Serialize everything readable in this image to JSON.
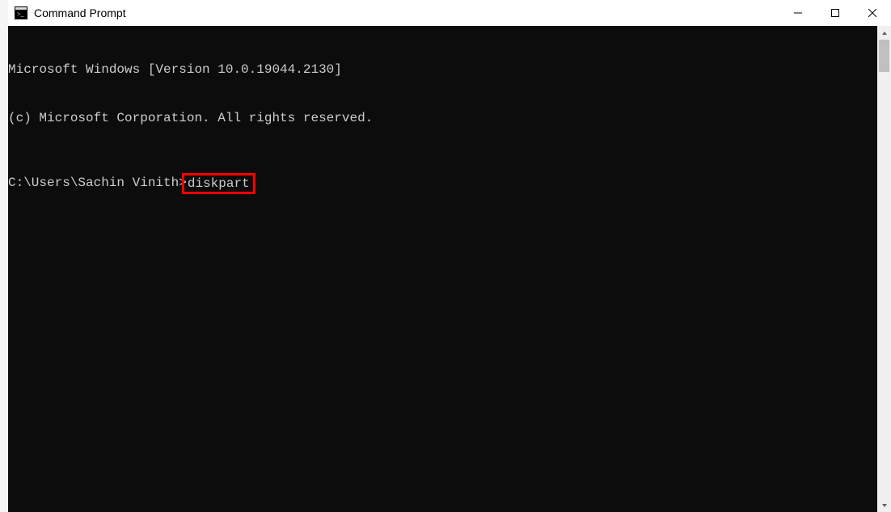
{
  "window": {
    "title": "Command Prompt"
  },
  "terminal": {
    "banner_line1": "Microsoft Windows [Version 10.0.19044.2130]",
    "banner_line2": "(c) Microsoft Corporation. All rights reserved.",
    "prompt": "C:\\Users\\Sachin Vinith>",
    "command": "diskpart"
  },
  "highlight": {
    "color": "#ff0000"
  }
}
